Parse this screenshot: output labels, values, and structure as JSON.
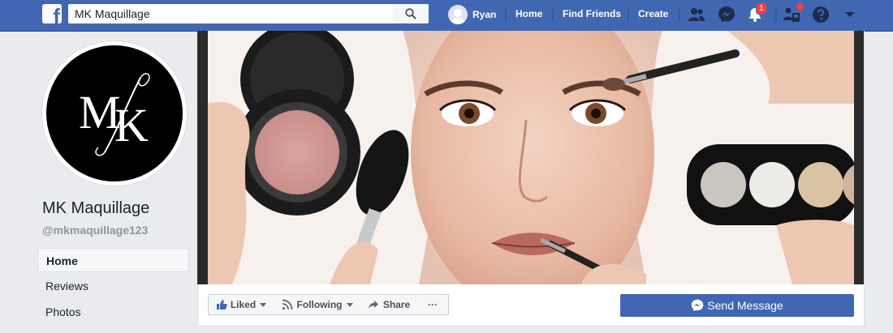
{
  "topbar": {
    "logo_letter": "f",
    "search_value": "MK Maquillage",
    "user_name": "Ryan",
    "nav": [
      "Home",
      "Find Friends",
      "Create"
    ],
    "notification_count": "1",
    "accent_color": "#4267b2"
  },
  "profile": {
    "name": "MK Maquillage",
    "handle": "@mkmaquillage123",
    "logo_text": "MK"
  },
  "sidebar": {
    "items": [
      {
        "label": "Home"
      },
      {
        "label": "Reviews"
      },
      {
        "label": "Photos"
      }
    ]
  },
  "actions": {
    "liked": "Liked",
    "following": "Following",
    "share": "Share",
    "more": "···",
    "send_message": "Send Message"
  }
}
